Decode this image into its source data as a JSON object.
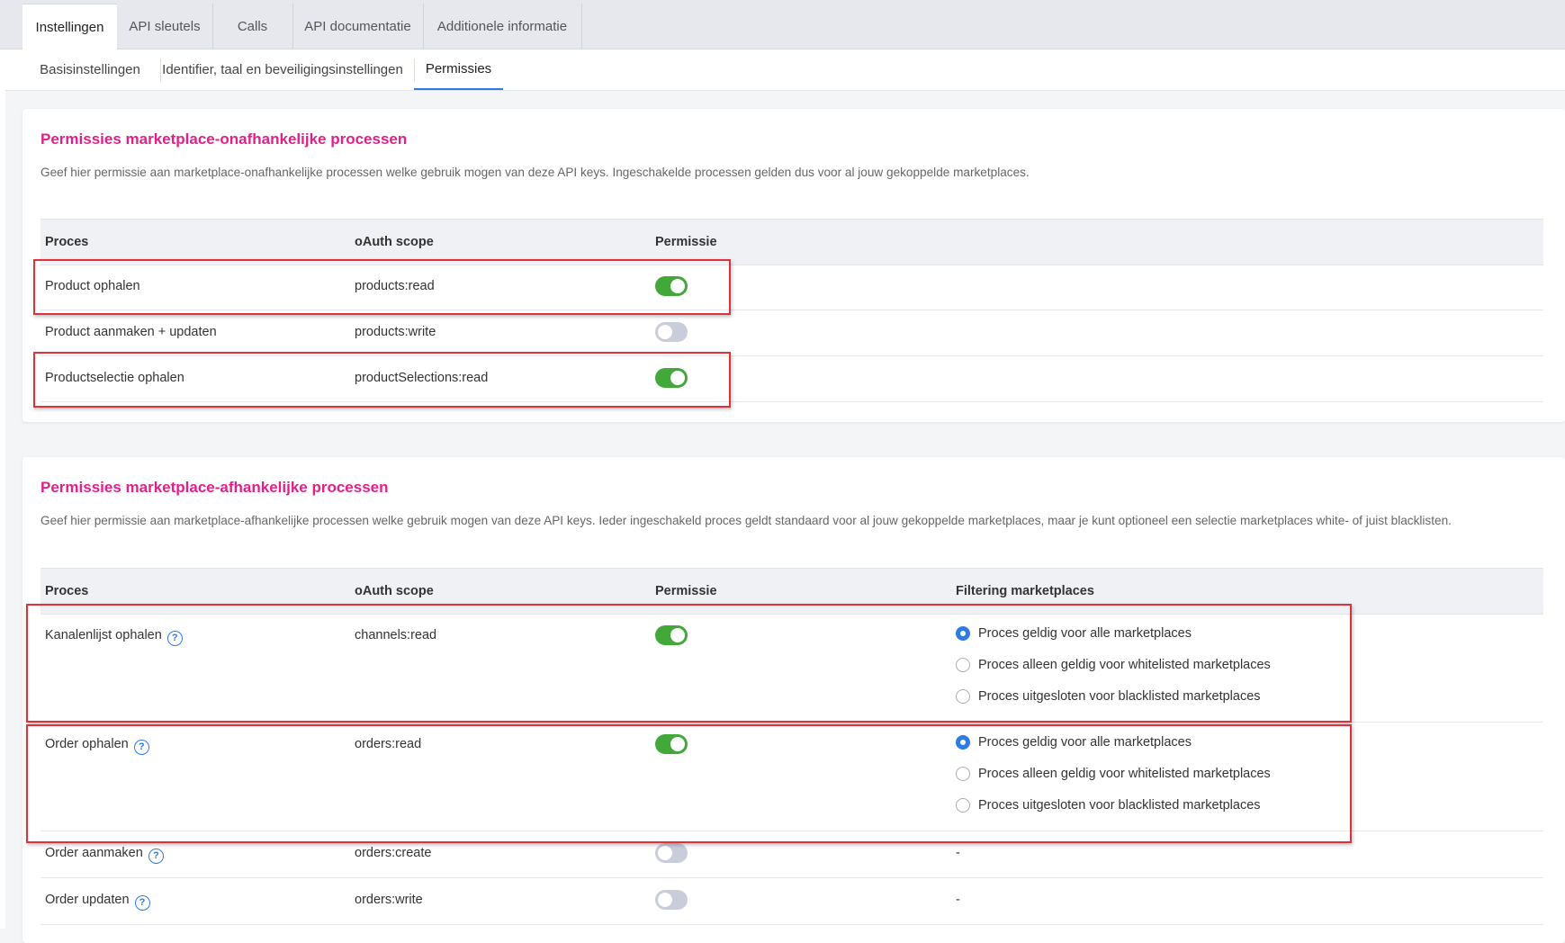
{
  "tabs": [
    "Instellingen",
    "API sleutels",
    "Calls",
    "API documentatie",
    "Additionele informatie"
  ],
  "subtabs": [
    "Basisinstellingen",
    "Identifier, taal en beveiligingsinstellingen",
    "Permissies"
  ],
  "section1": {
    "title": "Permissies marketplace-onafhankelijke processen",
    "description": "Geef hier permissie aan marketplace-onafhankelijke processen welke gebruik mogen van deze API keys. Ingeschakelde processen gelden dus voor al jouw gekoppelde marketplaces.",
    "headers": {
      "process": "Proces",
      "scope": "oAuth scope",
      "permission": "Permissie"
    },
    "rows": [
      {
        "process": "Product ophalen",
        "scope": "products:read",
        "enabled": true
      },
      {
        "process": "Product aanmaken + updaten",
        "scope": "products:write",
        "enabled": false
      },
      {
        "process": "Productselectie ophalen",
        "scope": "productSelections:read",
        "enabled": true
      }
    ]
  },
  "section2": {
    "title": "Permissies marketplace-afhankelijke processen",
    "description": "Geef hier permissie aan marketplace-afhankelijke processen welke gebruik mogen van deze API keys. Ieder ingeschakeld proces geldt standaard voor al jouw gekoppelde marketplaces, maar je kunt optioneel een selectie marketplaces white- of juist blacklisten.",
    "headers": {
      "process": "Proces",
      "scope": "oAuth scope",
      "permission": "Permissie",
      "filtering": "Filtering marketplaces"
    },
    "help_glyph": "?",
    "radio_options": [
      "Proces geldig voor alle marketplaces",
      "Proces alleen geldig voor whitelisted marketplaces",
      "Proces uitgesloten voor blacklisted marketplaces"
    ],
    "rows": [
      {
        "process": "Kanalenlijst ophalen",
        "scope": "channels:read",
        "enabled": true,
        "filtering_selected": 0
      },
      {
        "process": "Order ophalen",
        "scope": "orders:read",
        "enabled": true,
        "filtering_selected": 0
      },
      {
        "process": "Order aanmaken",
        "scope": "orders:create",
        "enabled": false,
        "filtering": "-"
      },
      {
        "process": "Order updaten",
        "scope": "orders:write",
        "enabled": false,
        "filtering": "-"
      }
    ]
  },
  "colors": {
    "accent": "#e0218a",
    "toggle_on": "#43a83a",
    "toggle_off": "#c9ccd9",
    "radio_checked": "#2d7be5",
    "highlight_box": "#e0303a"
  }
}
